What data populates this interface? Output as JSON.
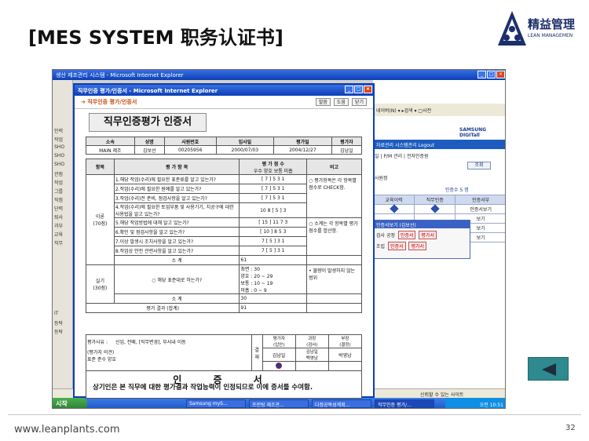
{
  "slide": {
    "title": "[MES SYSTEM 职务认证书]",
    "logo_text": "精益管理",
    "logo_sub": "LEAN MANAGEMEN",
    "footer_url": "www.leanplants.com",
    "page_number": "32"
  },
  "bg_window": {
    "title": "생산 제조관리 시스템 - Microsoft Internet Explorer",
    "left_items": [
      "인력",
      "작업",
      "SHO",
      "SHO",
      "SHO",
      "관점",
      "작업",
      "그룹",
      "직점",
      "단력",
      "퇴사",
      "과부",
      "교육",
      "직무"
    ],
    "left_lower": [
      "IT",
      "등탁",
      "등탁"
    ],
    "toolbar": "네이버(N) ▾   ▸검색 ▾ □사전",
    "brand": "SAMSUNG DIGITall",
    "menu": "자료관리   시스템관리   Logout",
    "crumb": "일 | P/M 관리 | 전자인증원",
    "search_btn": "조회",
    "select_label": "사원정",
    "count_text": "인증수   5 명",
    "table_headers": [
      "교육이력",
      "직무인증",
      "인증서부"
    ],
    "table_rows": [
      [
        "",
        "",
        "인증서보기"
      ],
      [
        "",
        "",
        "보기"
      ],
      [
        "",
        "",
        "보기"
      ],
      [
        "",
        "",
        "보기"
      ]
    ],
    "popup_title": "인증서보기 (김보선)",
    "popup_rows": [
      {
        "label": "검사 공정",
        "b1": "인증서",
        "b2": "평가서"
      },
      {
        "label": "조립",
        "b1": "인증서",
        "b2": "평가서"
      }
    ],
    "status": "신뢰할 수 있는 사이트"
  },
  "taskbar": {
    "start": "시작",
    "tasks": [
      "Samsung myS...",
      "프린팅 제조관...",
      "다정공목성계획...",
      "직무인증 평가/..."
    ],
    "clock": "오전 10:51"
  },
  "front_window": {
    "title": "직무인증 평가/인증서 - Microsoft Internet Explorer",
    "crumb": "직무인증 평가/인증서",
    "tools": [
      "말씀",
      "도움",
      "닫기"
    ],
    "cert_title": "직무인증평가 인증서",
    "info_headers": [
      "소속",
      "성명",
      "사원번호",
      "입사일",
      "평가일",
      "평가자"
    ],
    "info_values": [
      "MAIN 제조",
      "김보선",
      "00205956",
      "2000/07/03",
      "2004/12/27",
      "김남일"
    ],
    "eval_headers": {
      "item": "항목",
      "criteria": "평 가 항 목",
      "score": "평 가 점 수",
      "score_sub": "우수 양호 보통 미흡",
      "note": "비고"
    },
    "theory_label": "이론\n(70점)",
    "theory_rows": [
      {
        "text": "1.해당 작업(수리)에 필요한 표준류를 알고 있는가?",
        "score": "[ 7 ]    5      3      1"
      },
      {
        "text": "2.작업(수리)에 필요한 원예를 알고 있는가?",
        "score": "[ 7 ]    5      3      1"
      },
      {
        "text": "3.작업(수리)전 준비, 점검사항을 알고 있는가?",
        "score": "[ 7 ]    5      3      1"
      },
      {
        "text": "4.작업(수리)에 필요한 토업부품 및 사용기기, 치공구에 대한 사용법을 알고 있는가?",
        "score": "10      8    [ 5 ]   3"
      },
      {
        "text": "5.해당 작업방법에 대해 알고 있는가?",
        "score": "[ 15 ]   11     7      3"
      },
      {
        "text": "6.확인 및 점검사항을 알고 있는가?",
        "score": "[ 10 ]    8      5      3"
      },
      {
        "text": "7.이상 발생시 조치사항을 알고 있는가?",
        "score": "7    [ 5 ]    3      1"
      },
      {
        "text": "8.작업상 안전 관련사항을 알고 있는가?",
        "score": "7    [ 5 ]    3      1"
      }
    ],
    "theory_note1": "○ 평가항목은 각 항목별 점수로 CHECK함.",
    "theory_note2": "○ 소계는 각 항목별 평가 점수를 합산함.",
    "subtotal_label": "소          계",
    "theory_subtotal": "61",
    "practice_label": "실기\n(30점)",
    "practice_text": "○ 해당 표준대로 하는가?",
    "practice_scale": "최면 : 30\n양호 : 20 ~ 29\n보통 : 10 ~ 19\n미흡 : 0 ~ 9",
    "practice_note": "• 불량이 발생하지 않는 범위",
    "practice_subtotal": "30",
    "total_label": "평가 결과 (합계)",
    "total_value": "91",
    "reason_label": "평가사유 :",
    "reason_options": "신입,    전배,    [직무변경],   부서내 이동",
    "evaluator_opinion_label": "(평가자 의견)",
    "evaluator_opinion": "표준 준수 양호",
    "approval_label": "결\n재",
    "approval_headers": [
      "평가자\n(입안)",
      "과장\n(검사)",
      "부장\n(결정)"
    ],
    "approval_names": [
      "김남일",
      "김남일\n백영남",
      "박영남"
    ],
    "cert_heading": "인  증  서",
    "cert_text": "상기인은 본 직무에 대한 평가결과 작업능력이 인정되므로 이에 증서를 수여함."
  }
}
